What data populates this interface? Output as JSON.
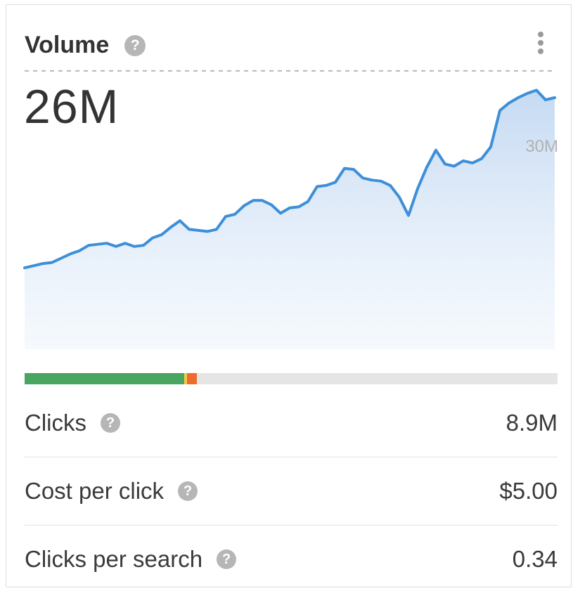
{
  "header": {
    "title": "Volume",
    "help_symbol": "?"
  },
  "volume": {
    "value": "26M"
  },
  "chart_data": {
    "type": "area",
    "y_max_label": "30M",
    "x": [
      0,
      1,
      2,
      3,
      4,
      5,
      6,
      7,
      8,
      9,
      10,
      11,
      12,
      13,
      14,
      15,
      16,
      17,
      18,
      19,
      20,
      21,
      22,
      23,
      24,
      25,
      26,
      27,
      28,
      29,
      30,
      31,
      32,
      33,
      34,
      35,
      36,
      37,
      38,
      39,
      40,
      41,
      42,
      43,
      44,
      45,
      46,
      47,
      48,
      49,
      50,
      51,
      52,
      53,
      54,
      55,
      56,
      57,
      58,
      59,
      60,
      61,
      62,
      63,
      64,
      65,
      66,
      67,
      68,
      69,
      70
    ],
    "values": [
      7.6,
      7.8,
      8.0,
      8.1,
      8.5,
      8.9,
      9.2,
      9.7,
      9.8,
      9.9,
      9.6,
      9.9,
      9.6,
      9.7,
      10.4,
      10.7,
      11.4,
      12.0,
      11.2,
      11.1,
      11.0,
      11.2,
      12.4,
      12.6,
      13.4,
      13.9,
      13.9,
      13.5,
      12.7,
      13.2,
      13.3,
      13.8,
      15.2,
      15.3,
      15.6,
      16.9,
      16.8,
      16.0,
      15.8,
      15.7,
      15.3,
      14.2,
      12.5,
      15.0,
      17.0,
      18.6,
      17.3,
      17.1,
      17.6,
      17.4,
      17.8,
      18.9,
      22.3,
      23.0,
      23.5,
      23.9,
      24.2,
      23.3,
      23.5
    ],
    "ylim": [
      0,
      30
    ],
    "reference_line": 26,
    "line_color": "#3d8fd9",
    "fill_color": "#c9dcf3"
  },
  "distribution_bar": {
    "segments": [
      {
        "share": 0.3,
        "color": "#4aa560"
      },
      {
        "share": 0.005,
        "color": "#f2c94c"
      },
      {
        "share": 0.018,
        "color": "#ee6a2d"
      }
    ],
    "track_color": "#e5e5e5"
  },
  "metrics": [
    {
      "label": "Clicks",
      "value": "8.9M"
    },
    {
      "label": "Cost per click",
      "value": "$5.00"
    },
    {
      "label": "Clicks per search",
      "value": "0.34"
    }
  ]
}
